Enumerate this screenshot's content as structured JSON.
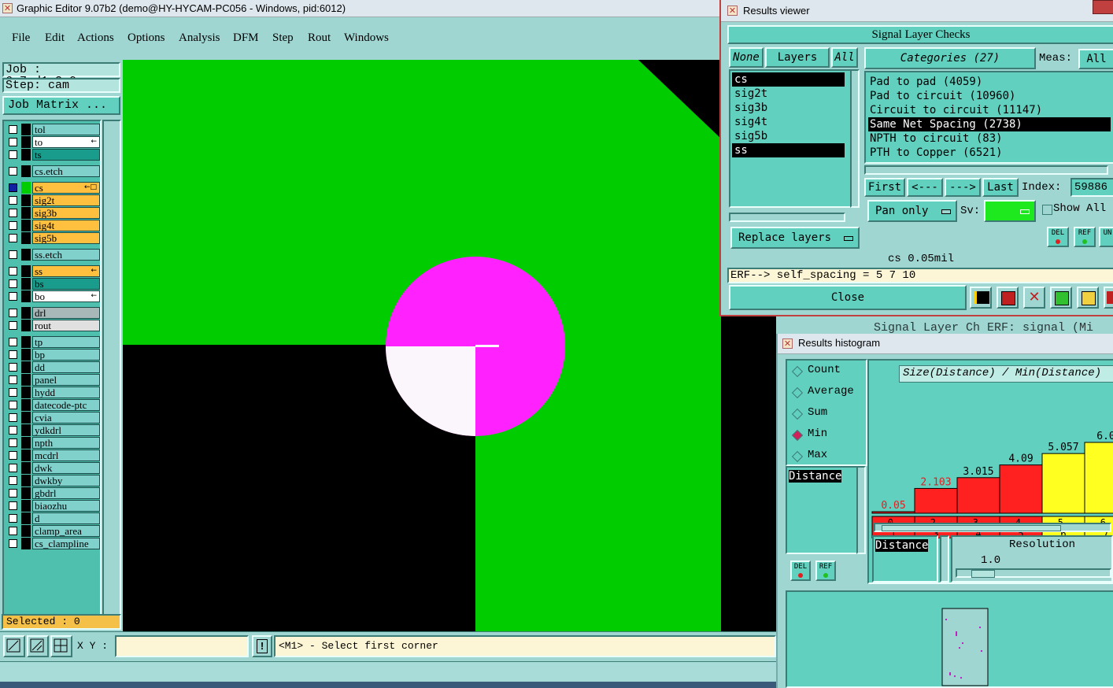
{
  "main_window": {
    "title": "Graphic Editor 9.07b2 (demo@HY-HYCAM-PC056 - Windows, pid:6012)",
    "menu": [
      "File",
      "Edit",
      "Actions",
      "Options",
      "Analysis",
      "DFM",
      "Step",
      "Rout",
      "Windows"
    ],
    "job_label": "Job : 6s7md1n2a0",
    "step_label": "Step: cam",
    "job_matrix_button": "Job Matrix ...",
    "layers": [
      {
        "name": "tol",
        "color": "#80d0cc"
      },
      {
        "name": "to",
        "color": "#ffffff",
        "mark": "←"
      },
      {
        "name": "ts",
        "color": "#1a9c8c"
      },
      {
        "name": "cs.etch",
        "color": "#80d0cc"
      },
      {
        "name": "cs",
        "color": "#ffc040",
        "mark": "←□",
        "active": true
      },
      {
        "name": "sig2t",
        "color": "#ffc040"
      },
      {
        "name": "sig3b",
        "color": "#ffc040"
      },
      {
        "name": "sig4t",
        "color": "#ffc040"
      },
      {
        "name": "sig5b",
        "color": "#ffc040"
      },
      {
        "name": "ss.etch",
        "color": "#80d0cc"
      },
      {
        "name": "ss",
        "color": "#ffc040",
        "mark": "←"
      },
      {
        "name": "bs",
        "color": "#1a9c8c"
      },
      {
        "name": "bo",
        "color": "#ffffff",
        "mark": "←"
      },
      {
        "name": "drl",
        "color": "#a8b8b8"
      },
      {
        "name": "rout",
        "color": "#e0e0e0"
      },
      {
        "name": "tp",
        "color": "#80d0cc"
      },
      {
        "name": "bp",
        "color": "#80d0cc"
      },
      {
        "name": "dd",
        "color": "#80d0cc"
      },
      {
        "name": "panel",
        "color": "#80d0cc"
      },
      {
        "name": "hydd",
        "color": "#80d0cc"
      },
      {
        "name": "datecode-ptc",
        "color": "#80d0cc"
      },
      {
        "name": "cvia",
        "color": "#80d0cc"
      },
      {
        "name": "ydkdrl",
        "color": "#80d0cc"
      },
      {
        "name": "npth",
        "color": "#80d0cc"
      },
      {
        "name": "mcdrl",
        "color": "#80d0cc"
      },
      {
        "name": "dwk",
        "color": "#80d0cc"
      },
      {
        "name": "dwkby",
        "color": "#80d0cc"
      },
      {
        "name": "gbdrl",
        "color": "#80d0cc"
      },
      {
        "name": "biaozhu",
        "color": "#80d0cc"
      },
      {
        "name": "d",
        "color": "#80d0cc"
      },
      {
        "name": "clamp_area",
        "color": "#80d0cc"
      },
      {
        "name": "cs_clampline",
        "color": "#80d0cc"
      }
    ],
    "selected_label": "Selected : 0",
    "xy_label": "X Y :",
    "xy_value": "",
    "status_prompt": "<M1> - Select first corner",
    "colors": {
      "board_green": "#00cc00",
      "highlight_magenta": "#ff22ff",
      "background_black": "#000000",
      "pad_white": "#fbf6fb"
    }
  },
  "results_viewer": {
    "title": "Results viewer",
    "header": "Signal Layer Checks",
    "none_button": "None",
    "layers_button": "Layers",
    "all_button": "All",
    "layer_list": [
      "cs",
      "sig2t",
      "sig3b",
      "sig4t",
      "sig5b",
      "ss"
    ],
    "categories_button": "Categories (27)",
    "meas_label": "Meas:",
    "meas_value": "All",
    "categories": [
      "Pad to pad (4059)",
      "Pad to circuit (10960)",
      "Circuit to circuit (11147)",
      "Same Net Spacing (2738)",
      "NPTH to circuit (83)",
      "PTH to Copper (6521)"
    ],
    "selected_category": "Same Net Spacing (2738)",
    "first_button": "First",
    "prev_button": "<---",
    "next_button": "--->",
    "last_button": "Last",
    "index_label": "Index:",
    "index_value": "59886",
    "pan_mode": "Pan only",
    "sv_label": "Sv:",
    "show_all_label": "Show All",
    "replace_layers_button": "Replace layers",
    "del_label": "DEL",
    "ref_label": "REF",
    "un_label": "UN",
    "status_line": "cs 0.05mil",
    "erf_line": "ERF--> self_spacing = 5 7 10",
    "close_button": "Close",
    "behind_window_text": "Signal Layer Ch ERF: signal (Mi"
  },
  "results_histogram": {
    "title": "Results histogram",
    "modes": [
      "Count",
      "Average",
      "Sum",
      "Min",
      "Max"
    ],
    "selected_mode": "Min",
    "field_list": [
      "Distance"
    ],
    "field_list_2": [
      "Distance"
    ],
    "header_label": "Size(Distance) / Min(Distance)",
    "resolution_label": "Resolution",
    "resolution_value": "1.0",
    "del_label": "DEL",
    "ref_label": "REF",
    "chart_data": {
      "type": "bar",
      "categories": [
        "0-\n1",
        "2-\n3",
        "3-\n4",
        "4-\n5",
        "5-\n6",
        "6-\n7"
      ],
      "values": [
        0.05,
        2.103,
        3.015,
        4.09,
        5.057,
        6.0
      ],
      "value_labels": [
        "0.05",
        "2.103",
        "3.015",
        "4.09",
        "5.057",
        "6.0"
      ],
      "colors": [
        "#ff2020",
        "#ff2020",
        "#ff2020",
        "#ff2020",
        "#ffff20",
        "#ffff20"
      ],
      "title": "Size(Distance) / Min(Distance)"
    }
  }
}
